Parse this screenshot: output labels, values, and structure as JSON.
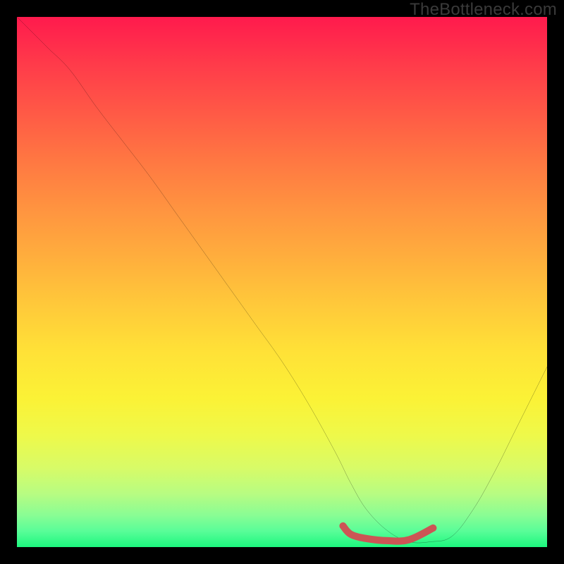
{
  "watermark": "TheBottleneck.com",
  "colors": {
    "background": "#000000",
    "curve_stroke": "#000000",
    "marker_stroke": "#cc5555",
    "gradient_top": "#ff1a4d",
    "gradient_bottom": "#1cf77e"
  },
  "chart_data": {
    "type": "line",
    "title": "",
    "xlabel": "",
    "ylabel": "",
    "xlim": [
      0,
      100
    ],
    "ylim": [
      0,
      100
    ],
    "grid": false,
    "legend": false,
    "series": [
      {
        "name": "bottleneck-curve",
        "x": [
          0,
          3,
          6,
          10,
          15,
          20,
          25,
          30,
          35,
          40,
          45,
          50,
          55,
          60,
          63,
          66,
          70,
          74,
          78,
          82,
          86,
          90,
          94,
          98,
          100
        ],
        "values": [
          100,
          97,
          94,
          90,
          83,
          76.5,
          70,
          63,
          56,
          49,
          42,
          35,
          27,
          18,
          12,
          7,
          3,
          1,
          1,
          2,
          7,
          14,
          22,
          30,
          34
        ]
      }
    ],
    "marker_segment": {
      "name": "optimal-range",
      "x": [
        61.5,
        63,
        66,
        70,
        74,
        78.5
      ],
      "values": [
        4.0,
        2.4,
        1.6,
        1.2,
        1.4,
        3.6
      ]
    }
  }
}
